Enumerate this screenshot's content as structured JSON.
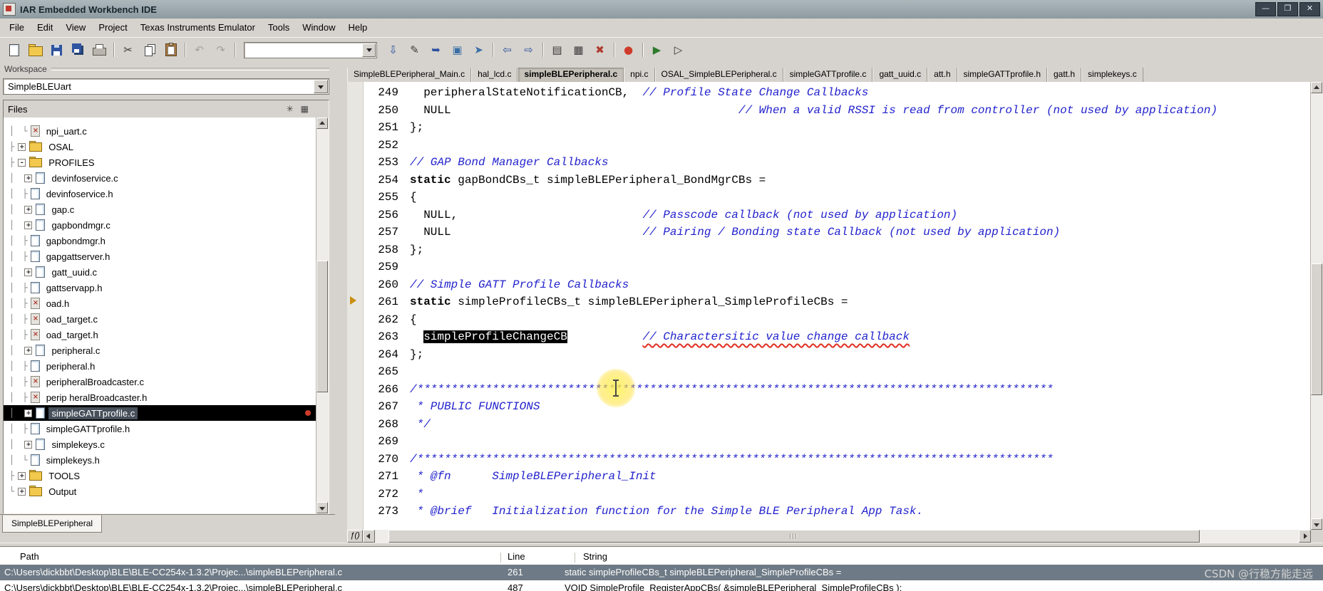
{
  "window": {
    "title": "IAR Embedded Workbench IDE",
    "buttons": [
      {
        "name": "minimize-button",
        "glyph": "—"
      },
      {
        "name": "maximize-button",
        "glyph": "❐"
      },
      {
        "name": "close-button",
        "glyph": "✕"
      }
    ]
  },
  "menu": [
    "File",
    "Edit",
    "View",
    "Project",
    "Texas Instruments Emulator",
    "Tools",
    "Window",
    "Help"
  ],
  "toolbar": {
    "items": [
      {
        "name": "new-file-button",
        "icon": "i-page"
      },
      {
        "name": "open-file-button",
        "icon": "i-folder"
      },
      {
        "name": "save-button",
        "icon": "i-floppy"
      },
      {
        "name": "save-all-button",
        "icon": "i-floppy2"
      },
      {
        "name": "print-button",
        "icon": "i-printer"
      },
      {
        "type": "sep"
      },
      {
        "name": "cut-button",
        "glyph": "✂",
        "color": "#3a3a3a"
      },
      {
        "name": "copy-button",
        "icon": "i-copy"
      },
      {
        "name": "paste-button",
        "icon": "i-paste"
      },
      {
        "type": "sep"
      },
      {
        "name": "undo-button",
        "glyph": "↶",
        "disabled": true
      },
      {
        "name": "redo-button",
        "glyph": "↷",
        "disabled": true
      },
      {
        "type": "sep"
      },
      {
        "type": "combo",
        "value": ""
      },
      {
        "name": "find-next-button",
        "glyph": "⇩",
        "color": "#2a4f9e"
      },
      {
        "name": "replace-button",
        "glyph": "✎",
        "color": "#3a3a3a"
      },
      {
        "name": "goto-line-button",
        "glyph": "➥",
        "color": "#2a4f9e"
      },
      {
        "name": "toggle-bookmark-button",
        "glyph": "▣",
        "color": "#3a6ea5"
      },
      {
        "name": "next-bookmark-button",
        "glyph": "➤",
        "color": "#3a6ea5"
      },
      {
        "type": "sep"
      },
      {
        "name": "navigate-backward-button",
        "glyph": "⇦",
        "color": "#2a4f9e"
      },
      {
        "name": "navigate-forward-button",
        "glyph": "⇨",
        "color": "#2a4f9e"
      },
      {
        "type": "sep"
      },
      {
        "name": "compile-button",
        "glyph": "▤",
        "color": "#3a3a3a"
      },
      {
        "name": "make-button",
        "glyph": "▦",
        "color": "#3a3a3a"
      },
      {
        "name": "stop-build-button",
        "glyph": "✖",
        "color": "#b03a2e"
      },
      {
        "type": "sep"
      },
      {
        "name": "toggle-breakpoint-button",
        "glyph": "●",
        "color": "#cf3b2a"
      },
      {
        "type": "sep"
      },
      {
        "name": "download-and-debug-button",
        "glyph": "▶",
        "color": "#2f7a2f"
      },
      {
        "name": "debug-without-downloading-button",
        "glyph": "▷",
        "color": "#3a3a3a"
      }
    ]
  },
  "workspace": {
    "caption": "Workspace",
    "target_dropdown": "SimpleBLEUart",
    "files_header": "Files",
    "header_icons": [
      "✳",
      "▦"
    ],
    "bottom_tab": "SimpleBLEPeripheral",
    "tree": [
      {
        "prefix": "│ └",
        "icon": "x",
        "label": "npi_uart.c"
      },
      {
        "prefix": "├",
        "expand": "+",
        "icon": "folder",
        "label": "OSAL"
      },
      {
        "prefix": "├",
        "expand": "-",
        "icon": "folder",
        "label": "PROFILES"
      },
      {
        "prefix": "│ ",
        "expand": "+",
        "icon": "c",
        "label": "devinfoservice.c"
      },
      {
        "prefix": "│ ├",
        "icon": "h",
        "label": "devinfoservice.h"
      },
      {
        "prefix": "│ ",
        "expand": "+",
        "icon": "c",
        "label": "gap.c"
      },
      {
        "prefix": "│ ",
        "expand": "+",
        "icon": "c",
        "label": "gapbondmgr.c"
      },
      {
        "prefix": "│ ├",
        "icon": "h",
        "label": "gapbondmgr.h"
      },
      {
        "prefix": "│ ├",
        "icon": "h",
        "label": "gapgattserver.h"
      },
      {
        "prefix": "│ ",
        "expand": "+",
        "icon": "c",
        "label": "gatt_uuid.c"
      },
      {
        "prefix": "│ ├",
        "icon": "h",
        "label": "gattservapp.h"
      },
      {
        "prefix": "│ ├",
        "icon": "x",
        "label": "oad.h"
      },
      {
        "prefix": "│ ├",
        "icon": "x",
        "label": "oad_target.c"
      },
      {
        "prefix": "│ ├",
        "icon": "x",
        "label": "oad_target.h"
      },
      {
        "prefix": "│ ",
        "expand": "+",
        "icon": "c",
        "label": "peripheral.c"
      },
      {
        "prefix": "│ ├",
        "icon": "h",
        "label": "peripheral.h"
      },
      {
        "prefix": "│ ├",
        "icon": "x",
        "label": "peripheralBroadcaster.c"
      },
      {
        "prefix": "│ ├",
        "icon": "x",
        "label": "perip heralBroadcaster.h"
      },
      {
        "prefix": "│ ",
        "expand": "+",
        "icon": "c",
        "label": "simpleGATTprofile.c",
        "selected": true,
        "mark": "red-dot"
      },
      {
        "prefix": "│ ├",
        "icon": "h",
        "label": "simpleGATTprofile.h"
      },
      {
        "prefix": "│ ",
        "expand": "+",
        "icon": "c",
        "label": "simplekeys.c"
      },
      {
        "prefix": "│ └",
        "icon": "h",
        "label": "simplekeys.h"
      },
      {
        "prefix": "├",
        "expand": "+",
        "icon": "folder",
        "label": "TOOLS"
      },
      {
        "prefix": "└",
        "expand": "+",
        "icon": "folder",
        "label": "Output"
      }
    ]
  },
  "editor": {
    "fn_button_label": "ƒ()",
    "tabs": [
      {
        "label": "SimpleBLEPeripheral_Main.c",
        "active": false
      },
      {
        "label": "hal_lcd.c",
        "active": false
      },
      {
        "label": "simpleBLEPeripheral.c",
        "active": true
      },
      {
        "label": "npi.c",
        "active": false
      },
      {
        "label": "OSAL_SimpleBLEPeripheral.c",
        "active": false
      },
      {
        "label": "simpleGATTprofile.c",
        "active": false
      },
      {
        "label": "gatt_uuid.c",
        "active": false
      },
      {
        "label": "att.h",
        "active": false
      },
      {
        "label": "simpleGATTprofile.h",
        "active": false
      },
      {
        "label": "gatt.h",
        "active": false
      },
      {
        "label": "simplekeys.c",
        "active": false
      }
    ],
    "lines": [
      {
        "n": 249,
        "seg": [
          [
            "pl",
            "  peripheralStateNotificationCB,  "
          ],
          [
            "cm",
            "// Profile State Change Callbacks"
          ]
        ]
      },
      {
        "n": 250,
        "seg": [
          [
            "pl",
            "  NULL                                          "
          ],
          [
            "cm",
            "// When a valid RSSI is read from controller (not used by application)"
          ]
        ]
      },
      {
        "n": 251,
        "seg": [
          [
            "pl",
            "};"
          ]
        ]
      },
      {
        "n": 252,
        "seg": []
      },
      {
        "n": 253,
        "seg": [
          [
            "cm",
            "// GAP Bond Manager Callbacks"
          ]
        ]
      },
      {
        "n": 254,
        "seg": [
          [
            "kw",
            "static"
          ],
          [
            "pl",
            " gapBondCBs_t simpleBLEPeripheral_BondMgrCBs ="
          ]
        ]
      },
      {
        "n": 255,
        "seg": [
          [
            "pl",
            "{"
          ]
        ]
      },
      {
        "n": 256,
        "seg": [
          [
            "pl",
            "  NULL,                           "
          ],
          [
            "cm",
            "// Passcode callback (not used by application)"
          ]
        ]
      },
      {
        "n": 257,
        "seg": [
          [
            "pl",
            "  NULL                            "
          ],
          [
            "cm",
            "// Pairing / Bonding state Callback (not used by application)"
          ]
        ]
      },
      {
        "n": 258,
        "seg": [
          [
            "pl",
            "};"
          ]
        ]
      },
      {
        "n": 259,
        "seg": []
      },
      {
        "n": 260,
        "seg": [
          [
            "cm",
            "// Simple GATT Profile Callbacks"
          ]
        ]
      },
      {
        "n": 261,
        "seg": [
          [
            "kw",
            "static"
          ],
          [
            "pl",
            " simpleProfileCBs_t simpleBLEPeripheral_SimpleProfileCBs ="
          ]
        ]
      },
      {
        "n": 262,
        "seg": [
          [
            "pl",
            "{"
          ]
        ]
      },
      {
        "n": 263,
        "seg": [
          [
            "pl",
            "  "
          ],
          [
            "sel",
            "simpleProfileChangeCB"
          ],
          [
            "pl",
            "           "
          ],
          [
            "cmu",
            "// Charactersitic value change callback"
          ]
        ]
      },
      {
        "n": 264,
        "seg": [
          [
            "pl",
            "};"
          ]
        ]
      },
      {
        "n": 265,
        "seg": []
      },
      {
        "n": 266,
        "seg": [
          [
            "cm",
            "/*********************************************************************************************"
          ]
        ]
      },
      {
        "n": 267,
        "seg": [
          [
            "cm",
            " * PUBLIC FUNCTIONS"
          ]
        ]
      },
      {
        "n": 268,
        "seg": [
          [
            "cm",
            " */"
          ]
        ]
      },
      {
        "n": 269,
        "seg": []
      },
      {
        "n": 270,
        "seg": [
          [
            "cm",
            "/*********************************************************************************************"
          ]
        ]
      },
      {
        "n": 271,
        "seg": [
          [
            "cm",
            " * @fn      SimpleBLEPeripheral_Init"
          ]
        ]
      },
      {
        "n": 272,
        "seg": [
          [
            "cm",
            " *"
          ]
        ]
      },
      {
        "n": 273,
        "seg": [
          [
            "cm",
            " * @brief   Initialization function for the Simple BLE Peripheral App Task."
          ]
        ]
      }
    ]
  },
  "bottom_panel": {
    "close_glyph": "×",
    "columns": [
      "Path",
      "Line",
      "String"
    ],
    "rows": [
      {
        "path": "C:\\Users\\dickbbt\\Desktop\\BLE\\BLE-CC254x-1.3.2\\Projec...\\simpleBLEPeripheral.c",
        "line": "261",
        "string": "static simpleProfileCBs_t simpleBLEPeripheral_SimpleProfileCBs =",
        "selected": true
      },
      {
        "path": "C:\\Users\\dickbbt\\Desktop\\BLE\\BLE-CC254x-1.3.2\\Projec...\\simpleBLEPeripheral.c",
        "line": "487",
        "string": "VOID SimpleProfile_RegisterAppCBs( &simpleBLEPeripheral_SimpleProfileCBs );",
        "selected": false
      }
    ]
  },
  "watermark": "CSDN @行稳方能走远"
}
